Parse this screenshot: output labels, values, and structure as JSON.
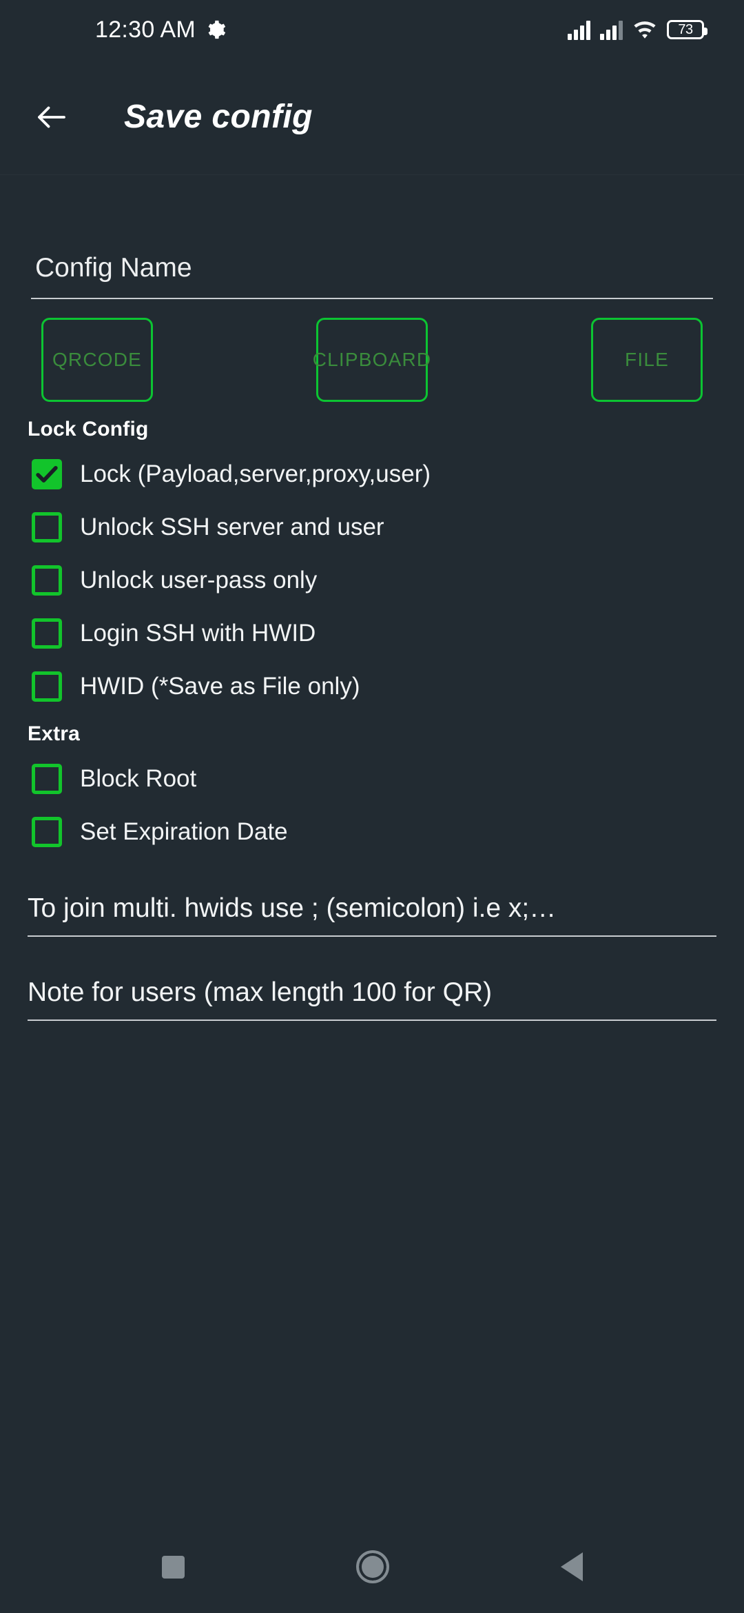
{
  "status_bar": {
    "clock": "12:30 AM",
    "gear_icon": "gear-icon",
    "signal_primary_icon": "signal-bars-icon",
    "signal_secondary_icon": "signal-bars-icon",
    "wifi_icon": "wifi-icon",
    "battery_level": "73"
  },
  "app_bar": {
    "back_icon": "back-arrow-icon",
    "title": "Save config"
  },
  "form": {
    "config_name": {
      "label": "Config Name",
      "value": "",
      "placeholder": "Config Name"
    },
    "save_targets": [
      {
        "label": "QRCODE",
        "name": "qrcode-button"
      },
      {
        "label": "CLIPBOARD",
        "name": "clipboard-button"
      },
      {
        "label": "FILE",
        "name": "file-button"
      }
    ],
    "lock_section": {
      "heading": "Lock Config",
      "options": [
        {
          "label": "Lock (Payload,server,proxy,user)",
          "checked": true
        },
        {
          "label": "Unlock SSH server and user",
          "checked": false
        },
        {
          "label": "Unlock user-pass only",
          "checked": false
        },
        {
          "label": "Login SSH with HWID",
          "checked": false
        },
        {
          "label": "HWID (*Save as File only)",
          "checked": false
        }
      ]
    },
    "extra_section": {
      "heading": "Extra",
      "options": [
        {
          "label": "Block Root",
          "checked": false
        },
        {
          "label": "Set Expiration Date",
          "checked": false
        }
      ]
    },
    "hwid_field": {
      "placeholder": "To join multi. hwids use ; (semicolon) i.e x;…",
      "value": ""
    },
    "note_field": {
      "placeholder": "Note for users (max length 100 for QR)",
      "value": ""
    }
  },
  "nav_bar": {
    "recents_icon": "square-recents-icon",
    "home_icon": "circle-home-icon",
    "back_icon": "triangle-back-icon"
  },
  "colors": {
    "background": "#222B32",
    "accent_green": "#12C42B",
    "button_border_green": "#0CC432",
    "button_text_green": "#3A8C3C",
    "text_primary": "#F2F4F5",
    "nav_icon_gray": "#838C92"
  }
}
